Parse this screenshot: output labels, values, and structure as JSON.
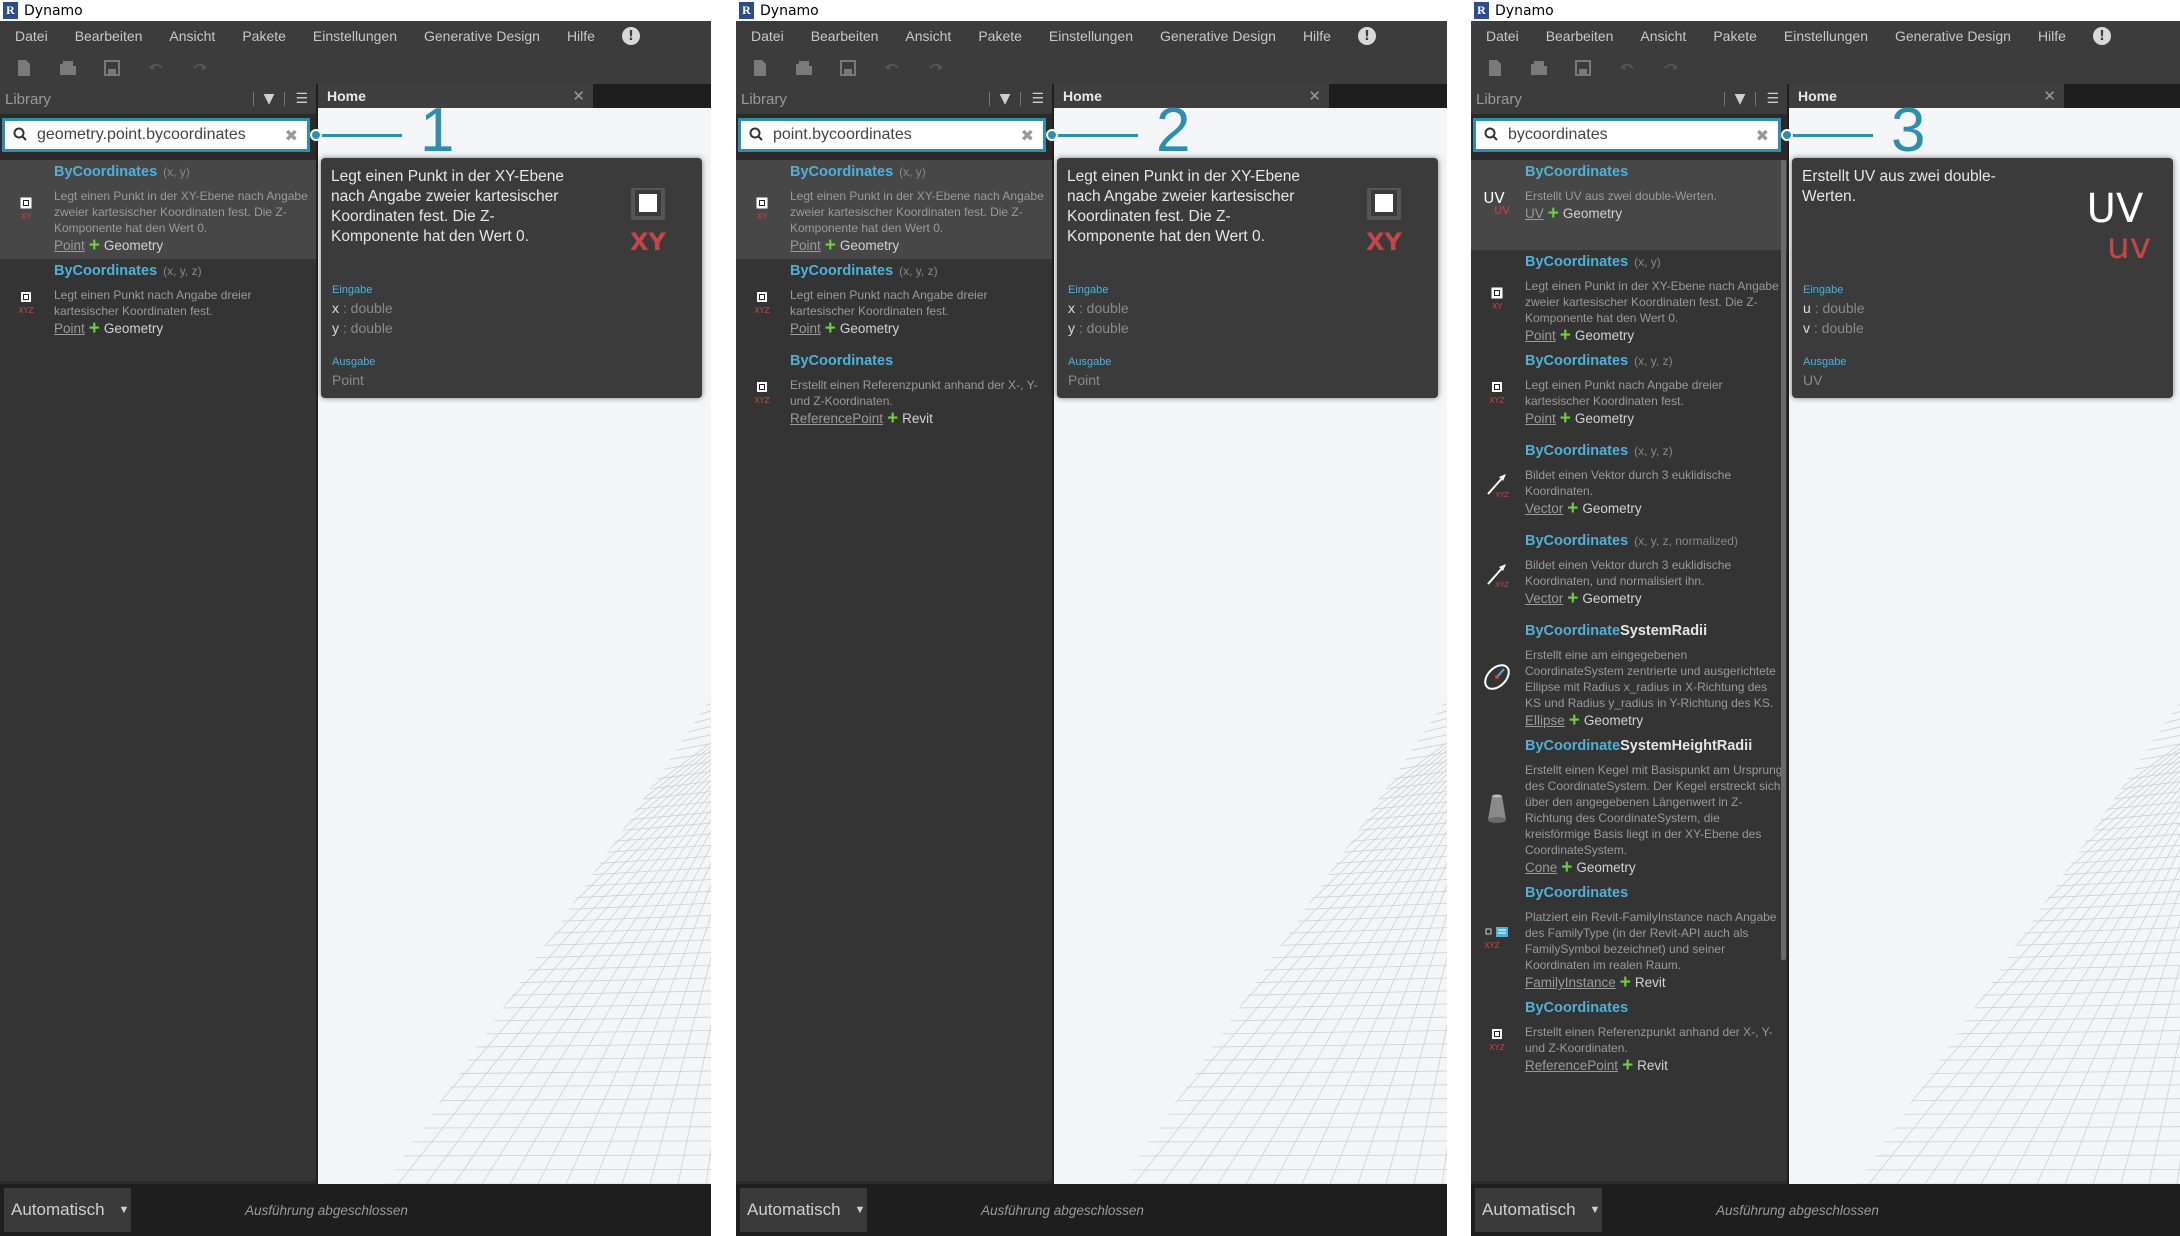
{
  "app": {
    "title": "Dynamo",
    "menu": [
      "Datei",
      "Bearbeiten",
      "Ansicht",
      "Pakete",
      "Einstellungen",
      "Generative Design",
      "Hilfe"
    ],
    "library_label": "Library",
    "tab_label": "Home",
    "run_mode": "Automatisch",
    "status": "Ausführung abgeschlossen",
    "accent": "#2d8fb0",
    "link_color": "#4fb0d8",
    "plus_color": "#6fcf3f"
  },
  "panels": [
    {
      "callout": "1",
      "search_value": "geometry.point.bycoordinates",
      "results": [
        {
          "name": "ByCoordinates",
          "params": "(x, y)",
          "desc": "Legt einen Punkt in der XY-Ebene nach Angabe zweier kartesischer Koordinaten fest. Die Z-Komponente hat den Wert 0.",
          "type": "Point",
          "category": "Geometry",
          "icon": "point-xy-icon"
        },
        {
          "name": "ByCoordinates",
          "params": "(x, y, z)",
          "desc": "Legt einen Punkt nach Angabe dreier kartesischer Koordinaten fest.",
          "type": "Point",
          "category": "Geometry",
          "icon": "point-xyz-icon"
        }
      ],
      "tooltip": {
        "desc": "Legt einen Punkt in der XY-Ebene nach Angabe zweier kartesischer Koordinaten fest. Die Z-Komponente hat den Wert 0.",
        "icon": "point-xy-icon",
        "icon_text": "XY",
        "input_label": "Eingabe",
        "inputs": [
          {
            "name": "x",
            "type": ": double"
          },
          {
            "name": "y",
            "type": ": double"
          }
        ],
        "output_label": "Ausgabe",
        "output": "Point"
      }
    },
    {
      "callout": "2",
      "search_value": "point.bycoordinates",
      "results": [
        {
          "name": "ByCoordinates",
          "params": "(x, y)",
          "desc": "Legt einen Punkt in der XY-Ebene nach Angabe zweier kartesischer Koordinaten fest. Die Z-Komponente hat den Wert 0.",
          "type": "Point",
          "category": "Geometry",
          "icon": "point-xy-icon"
        },
        {
          "name": "ByCoordinates",
          "params": "(x, y, z)",
          "desc": "Legt einen Punkt nach Angabe dreier kartesischer Koordinaten fest.",
          "type": "Point",
          "category": "Geometry",
          "icon": "point-xyz-icon"
        },
        {
          "name": "ByCoordinates",
          "params": "",
          "desc": "Erstellt einen Referenzpunkt anhand der X-, Y- und Z-Koordinaten.",
          "type": "ReferencePoint",
          "category": "Revit",
          "icon": "reference-point-icon"
        }
      ],
      "tooltip": {
        "desc": "Legt einen Punkt in der XY-Ebene nach Angabe zweier kartesischer Koordinaten fest. Die Z-Komponente hat den Wert 0.",
        "icon": "point-xy-icon",
        "icon_text": "XY",
        "input_label": "Eingabe",
        "inputs": [
          {
            "name": "x",
            "type": ": double"
          },
          {
            "name": "y",
            "type": ": double"
          }
        ],
        "output_label": "Ausgabe",
        "output": "Point"
      }
    },
    {
      "callout": "3",
      "search_value": "bycoordinates",
      "results": [
        {
          "name": "ByCoordinates",
          "params": "",
          "desc": "Erstellt UV aus zwei double-Werten.",
          "type": "UV",
          "category": "Geometry",
          "icon": "uv-icon"
        },
        {
          "name": "ByCoordinates",
          "params": "(x, y)",
          "desc": "Legt einen Punkt in der XY-Ebene nach Angabe zweier kartesischer Koordinaten fest. Die Z-Komponente hat den Wert 0.",
          "type": "Point",
          "category": "Geometry",
          "icon": "point-xy-icon"
        },
        {
          "name": "ByCoordinates",
          "params": "(x, y, z)",
          "desc": "Legt einen Punkt nach Angabe dreier kartesischer Koordinaten fest.",
          "type": "Point",
          "category": "Geometry",
          "icon": "point-xyz-icon"
        },
        {
          "name": "ByCoordinates",
          "params": "(x, y, z)",
          "desc": "Bildet einen Vektor durch 3 euklidische Koordinaten.",
          "type": "Vector",
          "category": "Geometry",
          "icon": "vector-icon"
        },
        {
          "name": "ByCoordinates",
          "params": "(x, y, z, normalized)",
          "desc": "Bildet einen Vektor durch 3 euklidische Koordinaten, und normalisiert ihn.",
          "type": "Vector",
          "category": "Geometry",
          "icon": "vector-icon"
        },
        {
          "name": "ByCoordinate",
          "name_suffix": "SystemRadii",
          "params": "",
          "desc": "Erstellt eine am eingegebenen CoordinateSystem zentrierte und ausgerichtete Ellipse mit Radius x_radius in X-Richtung des KS und Radius y_radius in Y-Richtung des KS.",
          "type": "Ellipse",
          "category": "Geometry",
          "icon": "ellipse-icon"
        },
        {
          "name": "ByCoordinate",
          "name_suffix": "SystemHeightRadii",
          "params": "",
          "desc": "Erstellt einen Kegel mit Basispunkt am Ursprung des CoordinateSystem. Der Kegel erstreckt sich über den angegebenen Längenwert in Z-Richtung des CoordinateSystem, die kreisförmige Basis liegt in der XY-Ebene des CoordinateSystem.",
          "type": "Cone",
          "category": "Geometry",
          "icon": "cone-icon"
        },
        {
          "name": "ByCoordinates",
          "params": "",
          "desc": "Platziert ein Revit-FamilyInstance nach Angabe des FamilyType (in der Revit-API auch als FamilySymbol bezeichnet) und seiner Koordinaten im realen Raum.",
          "type": "FamilyInstance",
          "category": "Revit",
          "icon": "family-instance-icon"
        },
        {
          "name": "ByCoordinates",
          "params": "",
          "desc": "Erstellt einen Referenzpunkt anhand der X-, Y- und Z-Koordinaten.",
          "type": "ReferencePoint",
          "category": "Revit",
          "icon": "reference-point-icon"
        }
      ],
      "tooltip": {
        "desc": "Erstellt UV aus zwei double-Werten.",
        "icon": "uv-icon",
        "icon_text": "UV",
        "input_label": "Eingabe",
        "inputs": [
          {
            "name": "u",
            "type": ": double"
          },
          {
            "name": "v",
            "type": ": double"
          }
        ],
        "output_label": "Ausgabe",
        "output": "UV"
      }
    }
  ]
}
